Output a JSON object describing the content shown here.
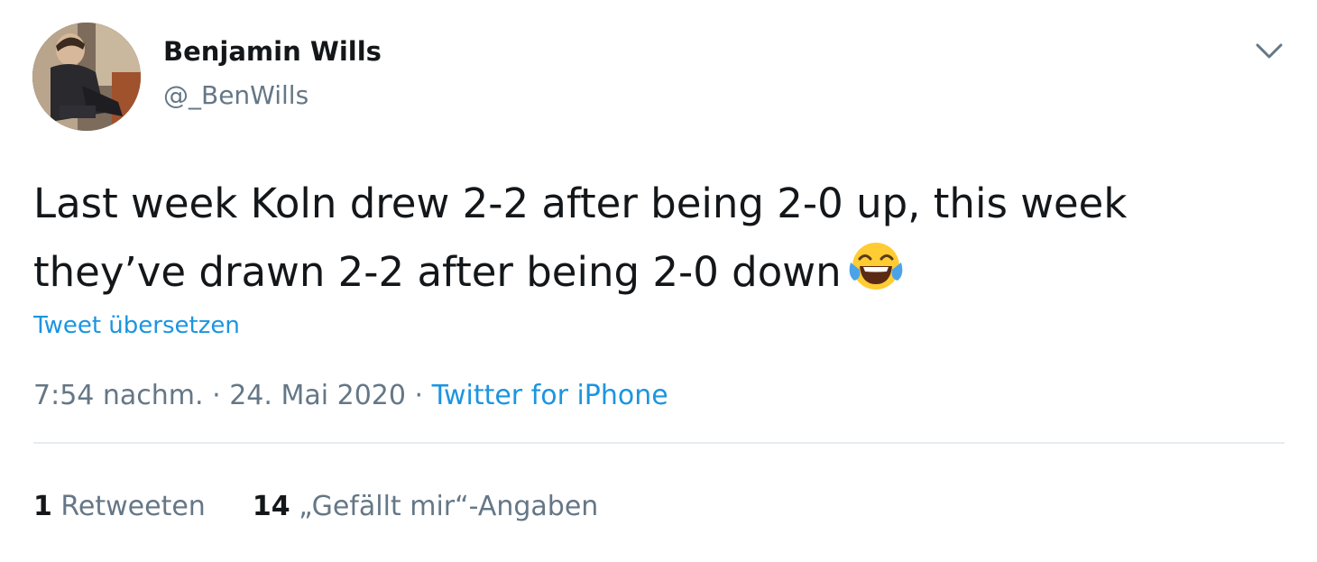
{
  "author": {
    "display_name": "Benjamin Wills",
    "handle": "@_BenWills"
  },
  "tweet": {
    "text": "Last week Koln drew 2-2 after being 2-0 up, this week they’ve drawn 2-2 after being 2-0 down",
    "emoji_icon": "tears-of-joy-emoji",
    "translate_label": "Tweet übersetzen"
  },
  "meta": {
    "time": "7:54 nachm.",
    "separator": "·",
    "date": "24. Mai 2020",
    "source": "Twitter for iPhone"
  },
  "stats": {
    "retweets_count": "1",
    "retweets_label": "Retweeten",
    "likes_count": "14",
    "likes_label": "„Gefällt mir“-Angaben"
  },
  "colors": {
    "link": "#1b95e0",
    "secondary_text": "#657786",
    "primary_text": "#14171a",
    "divider": "#e6ecf0"
  },
  "icons": {
    "menu": "chevron-down-icon"
  }
}
